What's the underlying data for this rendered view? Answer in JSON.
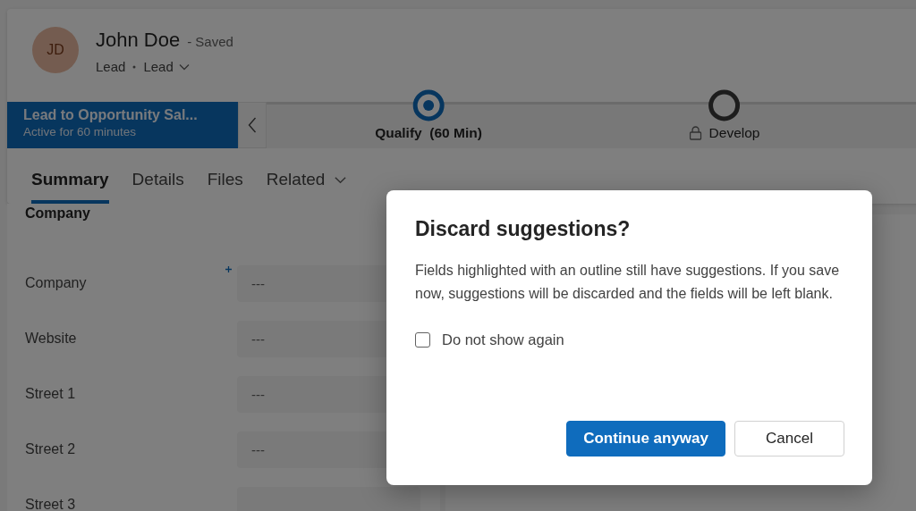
{
  "record": {
    "avatar_initials": "JD",
    "name": "John Doe",
    "status": "- Saved",
    "entity": "Lead",
    "form_name": "Lead"
  },
  "process": {
    "name": "Lead to Opportunity Sal...",
    "active_for": "Active for 60 minutes",
    "stages": [
      {
        "label": "Qualify  (60 Min)",
        "selected": true,
        "locked": false
      },
      {
        "label": "Develop",
        "selected": false,
        "locked": true
      }
    ]
  },
  "tabs": [
    {
      "label": "Summary",
      "selected": true,
      "kind": "plain"
    },
    {
      "label": "Details",
      "selected": false,
      "kind": "plain"
    },
    {
      "label": "Files",
      "selected": false,
      "kind": "plain"
    },
    {
      "label": "Related",
      "selected": false,
      "kind": "menu"
    }
  ],
  "section": {
    "title": "Company",
    "fields": [
      {
        "label": "Company",
        "value": "---",
        "recommended": true
      },
      {
        "label": "Website",
        "value": "---",
        "recommended": false
      },
      {
        "label": "Street 1",
        "value": "---",
        "recommended": false
      },
      {
        "label": "Street 2",
        "value": "---",
        "recommended": false
      },
      {
        "label": "Street 3",
        "recommended": false
      }
    ]
  },
  "dialog": {
    "title": "Discard suggestions?",
    "message": "Fields highlighted with an outline still have suggestions. If you save now, suggestions will be discarded and the fields will be left blank.",
    "checkbox": {
      "label": "Do not show again",
      "checked": false
    },
    "buttons": [
      {
        "label": "Continue anyway",
        "kind": "primary"
      },
      {
        "label": "Cancel",
        "kind": "secondary"
      }
    ]
  }
}
